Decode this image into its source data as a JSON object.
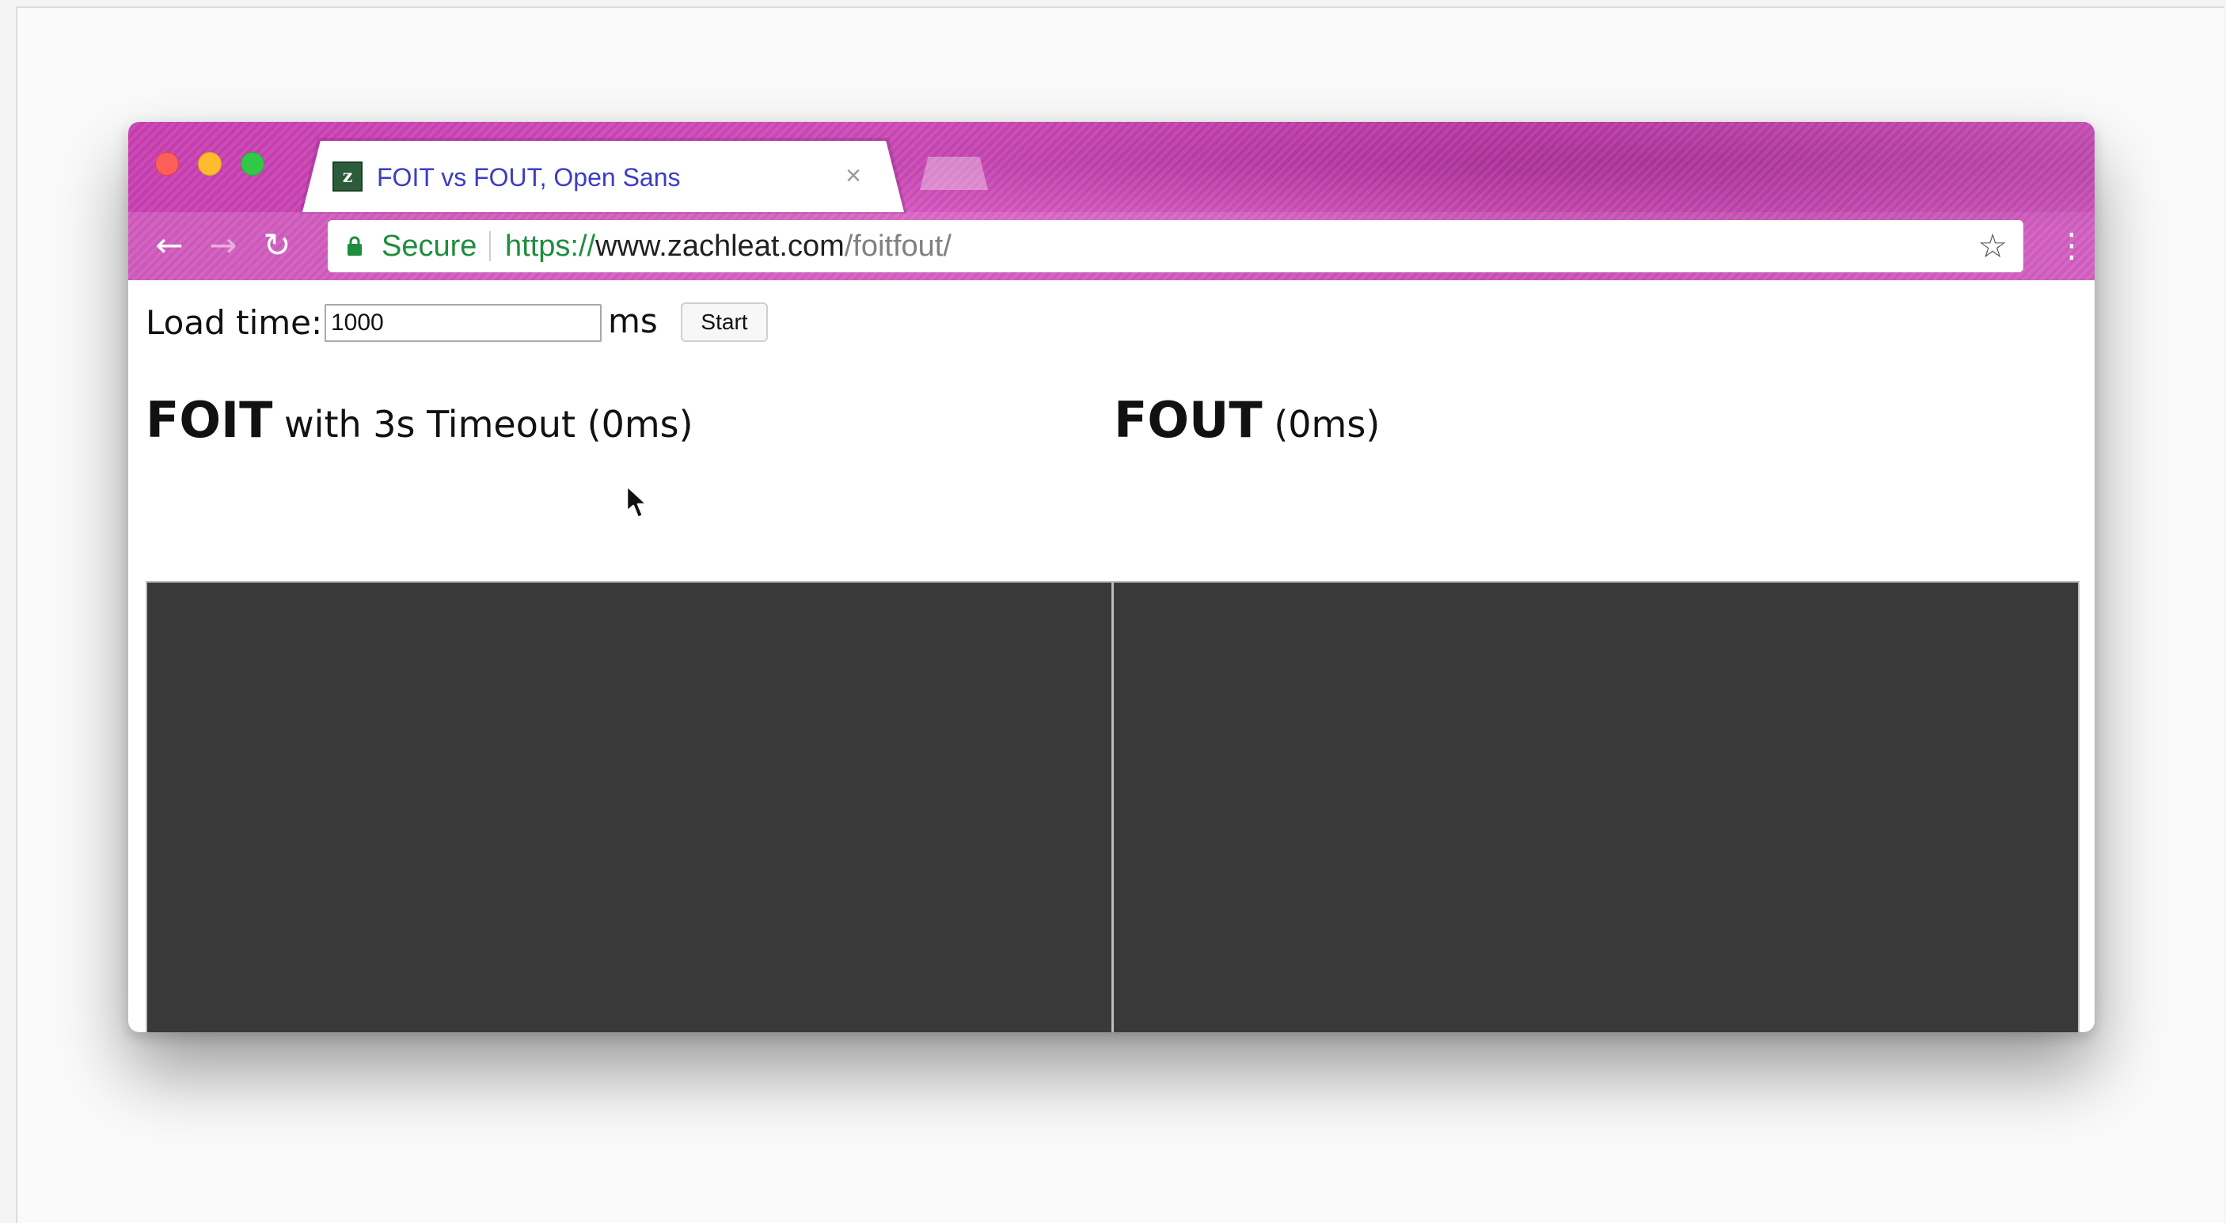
{
  "browser": {
    "tab_title": "FOIT vs FOUT, Open Sans",
    "favicon_letter": "z",
    "tab_close": "×",
    "security_label": "Secure",
    "url_scheme": "https://",
    "url_host": "www.zachleat.com",
    "url_path": "/foitfout/",
    "icons": {
      "back": "back-arrow-icon",
      "forward": "forward-arrow-icon",
      "reload": "reload-icon",
      "lock": "lock-icon",
      "star": "star-icon",
      "menu": "vertical-dots-menu-icon"
    },
    "accent_color": "#cc47b6"
  },
  "controls": {
    "load_label": "Load time:",
    "load_value": "1000",
    "unit_label": "ms",
    "start_label": "Start"
  },
  "panels": [
    {
      "title_strong": "FOIT",
      "title_rest": " with 3s Timeout (0ms)",
      "color": "#393939"
    },
    {
      "title_strong": "FOUT",
      "title_rest": " (0ms)",
      "color": "#393939"
    }
  ]
}
